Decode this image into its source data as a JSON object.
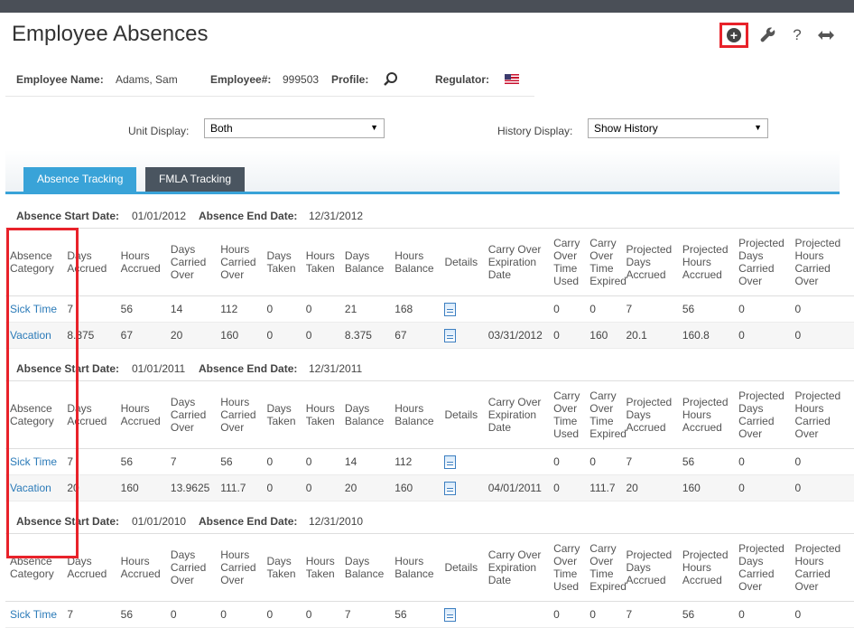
{
  "title": "Employee Absences",
  "toolbar": {
    "add_icon": "plus-circle-icon",
    "settings_icon": "wrench-icon",
    "help_label": "?",
    "expand_icon": "arrows-horizontal-icon",
    "highlight_color": "#e8222a"
  },
  "employee": {
    "name_label": "Employee Name:",
    "name_value": "Adams, Sam",
    "number_label": "Employee#:",
    "number_value": "999503",
    "profile_label": "Profile:",
    "regulator_label": "Regulator:"
  },
  "filters": {
    "unit_label": "Unit Display:",
    "unit_value": "Both",
    "history_label": "History Display:",
    "history_value": "Show History"
  },
  "tabs": [
    {
      "label": "Absence Tracking"
    },
    {
      "label": "FMLA Tracking"
    }
  ],
  "colors": {
    "accent": "#39a3d8",
    "link": "#2a7ab8",
    "tab_inactive": "#4a5560"
  },
  "columns": [
    "Absence Category",
    "Days Accrued",
    "Hours Accrued",
    "Days Carried Over",
    "Hours Carried Over",
    "Days Taken",
    "Hours Taken",
    "Days Balance",
    "Hours Balance",
    "Details",
    "Carry Over Expiration Date",
    "Carry Over Time Used",
    "Carry Over Time Expired",
    "Projected Days Accrued",
    "Projected Hours Accrued",
    "Projected Days Carried Over",
    "Projected Hours Carried Over"
  ],
  "periods": [
    {
      "start_label": "Absence Start Date:",
      "start": "01/01/2012",
      "end_label": "Absence End Date:",
      "end": "12/31/2012",
      "rows": [
        [
          "Sick Time",
          "7",
          "56",
          "14",
          "112",
          "0",
          "0",
          "21",
          "168",
          "",
          "",
          "0",
          "0",
          "7",
          "56",
          "0",
          "0"
        ],
        [
          "Vacation",
          "8.375",
          "67",
          "20",
          "160",
          "0",
          "0",
          "8.375",
          "67",
          "",
          "03/31/2012",
          "0",
          "160",
          "20.1",
          "160.8",
          "0",
          "0"
        ]
      ]
    },
    {
      "start_label": "Absence Start Date:",
      "start": "01/01/2011",
      "end_label": "Absence End Date:",
      "end": "12/31/2011",
      "rows": [
        [
          "Sick Time",
          "7",
          "56",
          "7",
          "56",
          "0",
          "0",
          "14",
          "112",
          "",
          "",
          "0",
          "0",
          "7",
          "56",
          "0",
          "0"
        ],
        [
          "Vacation",
          "20",
          "160",
          "13.9625",
          "111.7",
          "0",
          "0",
          "20",
          "160",
          "",
          "04/01/2011",
          "0",
          "111.7",
          "20",
          "160",
          "0",
          "0"
        ]
      ]
    },
    {
      "start_label": "Absence Start Date:",
      "start": "01/01/2010",
      "end_label": "Absence End Date:",
      "end": "12/31/2010",
      "rows": [
        [
          "Sick Time",
          "7",
          "56",
          "0",
          "0",
          "0",
          "0",
          "7",
          "56",
          "",
          "",
          "0",
          "0",
          "7",
          "56",
          "0",
          "0"
        ]
      ]
    }
  ]
}
